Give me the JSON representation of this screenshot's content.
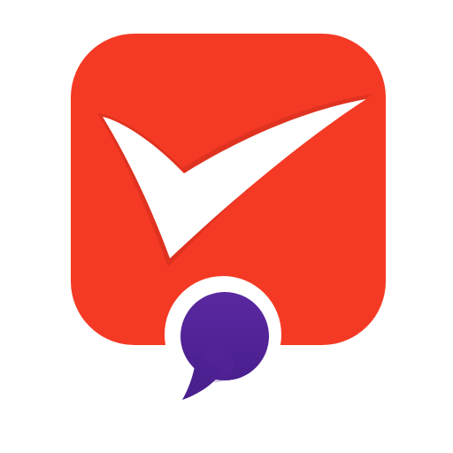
{
  "logo": {
    "colors": {
      "tile": "#F43A24",
      "tile_shadow": "#E03220",
      "check": "#FFFFFF",
      "bubble_top": "#5A28A0",
      "bubble_bottom": "#4A1F8E",
      "ring": "#FFFFFF",
      "background": "#FFFFFF"
    },
    "icons": [
      "rounded-square-tile",
      "checkmark-icon",
      "speech-bubble-icon"
    ]
  }
}
